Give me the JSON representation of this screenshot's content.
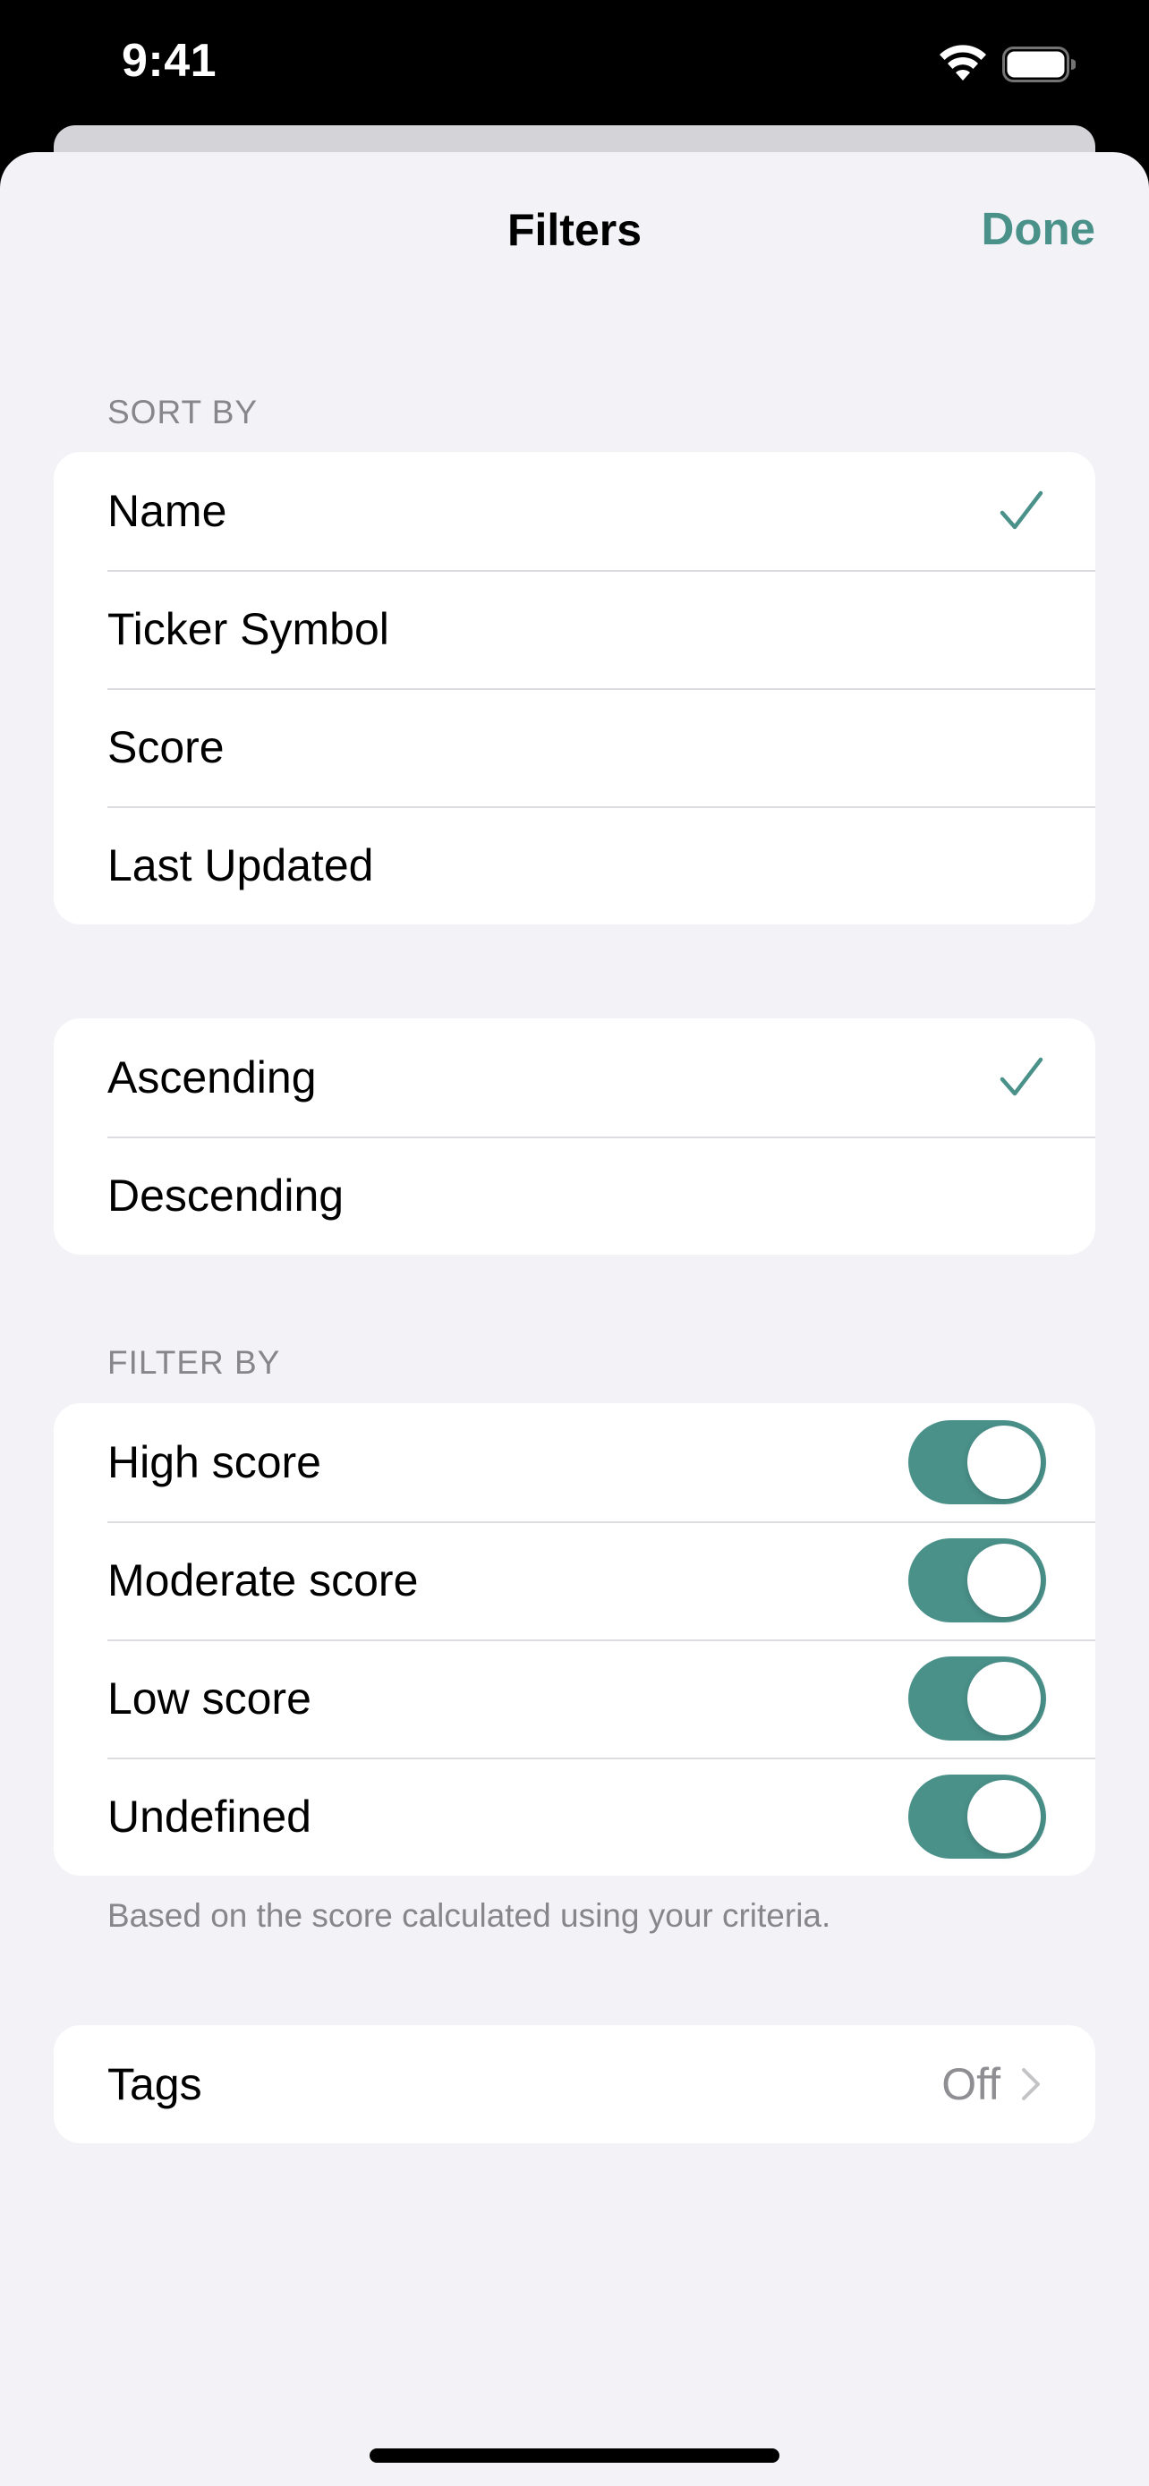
{
  "status_bar": {
    "time": "9:41"
  },
  "header": {
    "title": "Filters",
    "done_label": "Done"
  },
  "sort_by": {
    "header": "SORT BY",
    "options": [
      {
        "label": "Name",
        "selected": true
      },
      {
        "label": "Ticker Symbol",
        "selected": false
      },
      {
        "label": "Score",
        "selected": false
      },
      {
        "label": "Last Updated",
        "selected": false
      }
    ]
  },
  "order": {
    "options": [
      {
        "label": "Ascending",
        "selected": true
      },
      {
        "label": "Descending",
        "selected": false
      }
    ]
  },
  "filter_by": {
    "header": "FILTER BY",
    "toggles": [
      {
        "label": "High score",
        "on": true
      },
      {
        "label": "Moderate score",
        "on": true
      },
      {
        "label": "Low score",
        "on": true
      },
      {
        "label": "Undefined",
        "on": true
      }
    ],
    "footer": "Based on the score calculated using your criteria."
  },
  "tags": {
    "label": "Tags",
    "value": "Off"
  },
  "colors": {
    "accent": "#4a918a",
    "background": "#f2f2f7",
    "secondary_text": "#86868b"
  }
}
